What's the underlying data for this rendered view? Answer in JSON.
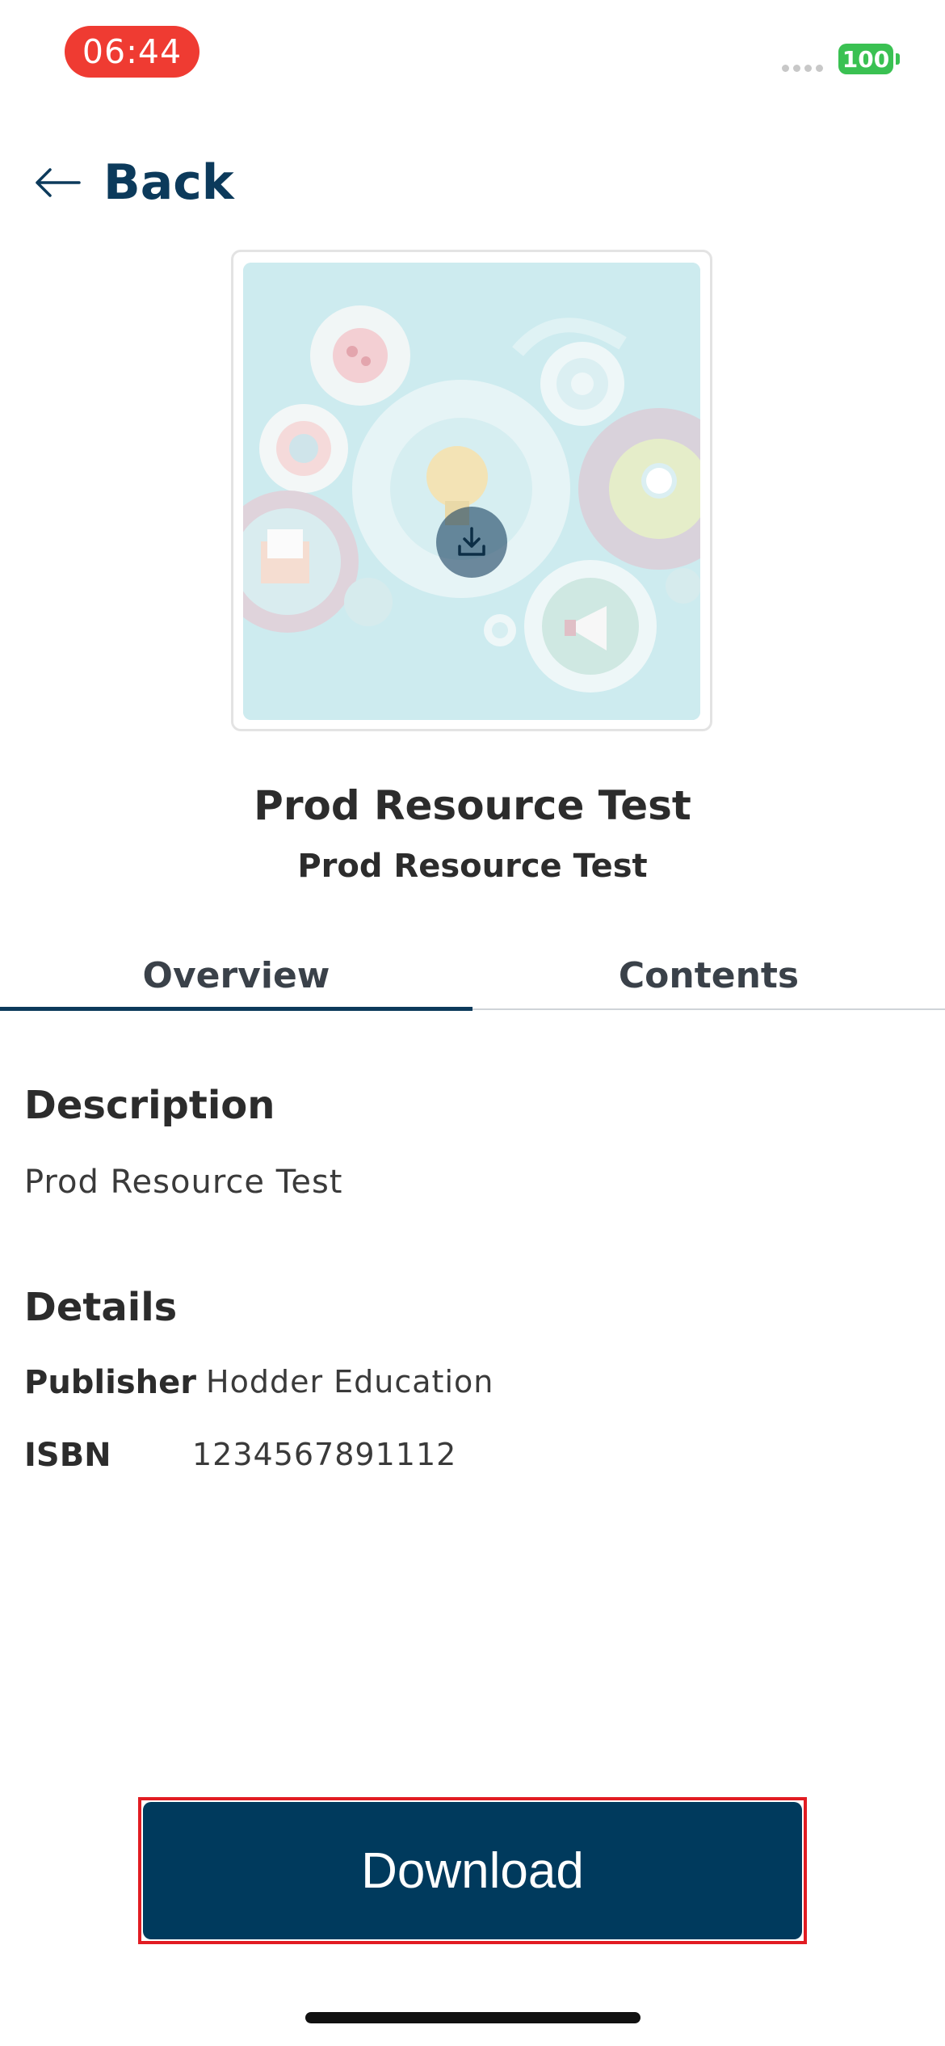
{
  "status_bar": {
    "time": "06:44",
    "battery": "100"
  },
  "nav": {
    "back_label": "Back"
  },
  "resource": {
    "title": "Prod Resource Test",
    "subtitle": "Prod Resource Test"
  },
  "tabs": [
    {
      "label": "Overview",
      "active": true
    },
    {
      "label": "Contents",
      "active": false
    }
  ],
  "overview": {
    "description_heading": "Description",
    "description_text": "Prod Resource Test",
    "details_heading": "Details",
    "details": [
      {
        "label": "Publisher",
        "value": "Hodder Education"
      },
      {
        "label": "ISBN",
        "value": "1234567891112"
      }
    ]
  },
  "actions": {
    "download_label": "Download"
  },
  "colors": {
    "primary": "#003a5d",
    "time_pill": "#ef3b32",
    "battery": "#3ac152",
    "highlight_outline": "#e11c22"
  }
}
